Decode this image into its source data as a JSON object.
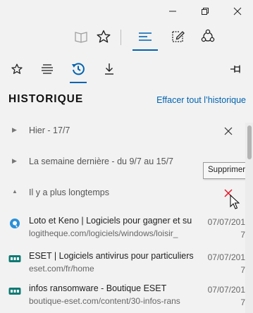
{
  "colors": {
    "accent": "#0063b1",
    "background": "#f2f2f2",
    "delete_hover": "#e81123"
  },
  "window_controls": [
    {
      "name": "minimize-icon"
    },
    {
      "name": "maximize-icon"
    },
    {
      "name": "close-icon"
    }
  ],
  "toolbar": {
    "items": [
      {
        "icon": "reading-view-icon",
        "state": "disabled"
      },
      {
        "icon": "favorites-star-icon"
      },
      {
        "icon": "hub-icon",
        "state": "active"
      },
      {
        "icon": "web-note-icon"
      },
      {
        "icon": "share-icon"
      }
    ]
  },
  "hub_tabs": [
    {
      "icon": "favorites-icon"
    },
    {
      "icon": "reading-list-icon"
    },
    {
      "icon": "history-icon",
      "state": "active"
    },
    {
      "icon": "downloads-icon"
    }
  ],
  "pin_icon": "pin-icon",
  "history": {
    "title": "HISTORIQUE",
    "clear_link": "Effacer tout l’historique",
    "tooltip": "Supprimer",
    "groups": [
      {
        "label": "Hier - 17/7",
        "expanded": false
      },
      {
        "label": "La semaine dernière - du 9/7 au 15/7",
        "expanded": false
      },
      {
        "label": "Il y a plus longtemps",
        "expanded": true
      }
    ],
    "items": [
      {
        "title": "Loto et Keno | Logiciels pour gagner et su",
        "url": "logitheque.com/logiciels/windows/loisir_",
        "date_line1": "07/07/201",
        "date_line2": "7",
        "favicon": "logitheque-icon"
      },
      {
        "title": "ESET | Logiciels antivirus pour particuliers",
        "url": "eset.com/fr/home",
        "date_line1": "07/07/201",
        "date_line2": "7",
        "favicon": "eset-icon"
      },
      {
        "title": "infos ransomware - Boutique ESET",
        "url": "boutique-eset.com/content/30-infos-rans",
        "date_line1": "07/07/201",
        "date_line2": "7",
        "favicon": "eset-icon"
      }
    ]
  }
}
